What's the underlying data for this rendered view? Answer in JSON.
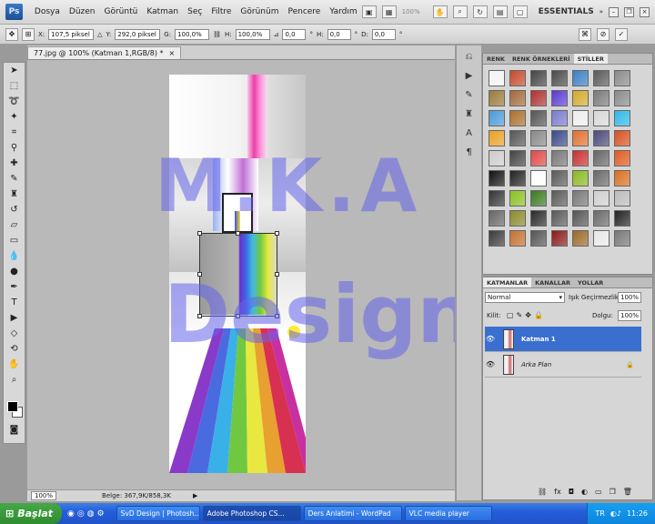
{
  "menubar": {
    "logo": "Ps",
    "items": [
      "Dosya",
      "Düzen",
      "Görüntü",
      "Katman",
      "Seç",
      "Filtre",
      "Görünüm",
      "Pencere",
      "Yardım"
    ],
    "zoom": "100%",
    "workspace": "ESSENTIALS"
  },
  "options": {
    "x_label": "X:",
    "x_value": "107,5 piksel",
    "y_label": "Y:",
    "y_value": "292,0 piksel",
    "w_label": "G:",
    "w_value": "100,0%",
    "h_label": "H:",
    "h_value": "100,0%",
    "angle_value": "0,0",
    "hskew_label": "H:",
    "hskew_value": "0,0",
    "vskew_label": "D:",
    "vskew_value": "0,0",
    "degree": "°"
  },
  "document": {
    "tab_title": "77.jpg @ 100% (Katman 1,RGB/8) *",
    "close_glyph": "×",
    "status_zoom": "100%",
    "status_info": "Belge: 367,9K/858,3K"
  },
  "watermark": {
    "line1": "M.K.A",
    "line2": "Design"
  },
  "styles_panel": {
    "tabs": [
      "RENK",
      "RENK ÖRNEKLERİ",
      "STİLLER"
    ],
    "swatches": [
      "#f4f4f4",
      "#c64a2a",
      "#444444",
      "#4a4a4a",
      "#3a7fc6",
      "#5a5a5a",
      "#8a8a8a",
      "#9a7a3a",
      "#a4693a",
      "#b03030",
      "#5a3ad0",
      "#d4aa2a",
      "#7a7a7a",
      "#8a8a8a",
      "#4a9ad6",
      "#a8702a",
      "#555555",
      "#7a7acc",
      "#eeeeee",
      "#d8d8d8",
      "#2fb8e8",
      "#e8a020",
      "#555555",
      "#888888",
      "#3a4a8a",
      "#e07030",
      "#4a4a7a",
      "#d85020",
      "#cccccc",
      "#444444",
      "#e04848",
      "#777777",
      "#c83030",
      "#666666",
      "#e05a20",
      "#111111",
      "#222222",
      "#ffffff",
      "#5a5a5a",
      "#8ab820",
      "#6a6a6a",
      "#d87020",
      "#333333",
      "#8ac020",
      "#3a7a20",
      "#5a5a5a",
      "#777777",
      "#cfcfcf",
      "#bbbbbb",
      "#666666",
      "#8a8a2a",
      "#2a2a2a",
      "#5a5a5a",
      "#555555",
      "#6a6a6a",
      "#222222",
      "#3a3a3a",
      "#c47030",
      "#555555",
      "#8a1a1a",
      "#9a6a2a",
      "#e8e8e8",
      "#777777"
    ]
  },
  "layers_panel": {
    "tabs": [
      "KATMANLAR",
      "KANALLAR",
      "YOLLAR"
    ],
    "blend_mode": "Normal",
    "opacity_label": "Işık Geçirmezlik:",
    "opacity_value": "100%",
    "lock_label": "Kilit:",
    "fill_label": "Dolgu:",
    "fill_value": "100%",
    "layers": [
      {
        "name": "Katman 1",
        "selected": true
      },
      {
        "name": "Arka Plan",
        "selected": false,
        "locked": true
      }
    ]
  },
  "taskbar": {
    "start": "Başlat",
    "buttons": [
      "SvD Design | Photosh...",
      "Adobe Photoshop CS...",
      "Ders Anlatimi - WordPad",
      "VLC media player"
    ],
    "active_index": 1,
    "language": "TR",
    "clock": "11:26"
  },
  "colors": {
    "layer_selected": "#3a6fcf",
    "watermark": "#6464eb"
  }
}
